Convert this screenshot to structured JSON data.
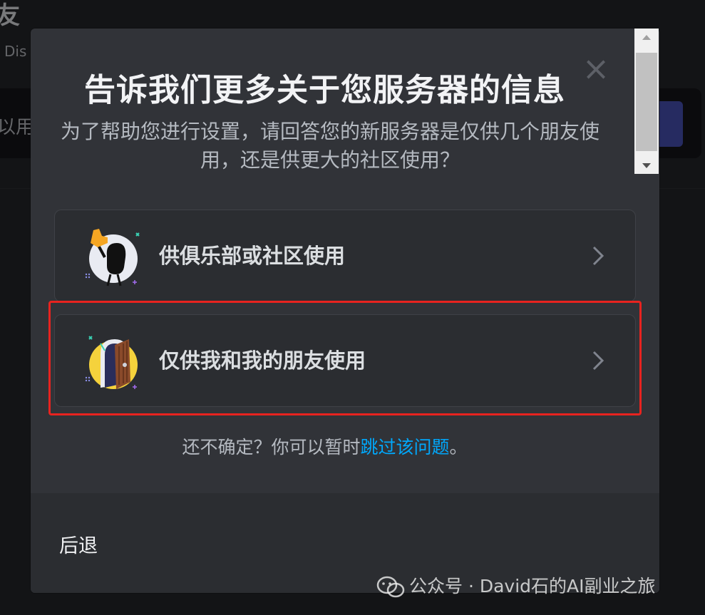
{
  "background": {
    "title_fragment": "友",
    "subtitle_fragment": "Dis",
    "bar_text_fragment": "以用"
  },
  "modal": {
    "title": "告诉我们更多关于您服务器的信息",
    "subtitle": "为了帮助您进行设置，请回答您的新服务器是仅供几个朋友使用，还是供更大的社区使用？",
    "close_icon": "close-icon",
    "options": [
      {
        "label": "供俱乐部或社区使用",
        "icon": "club-community-illustration-icon"
      },
      {
        "label": "仅供我和我的朋友使用",
        "icon": "friends-door-illustration-icon"
      }
    ],
    "skip_prefix": "还不确定？你可以暂时",
    "skip_link": "跳过该问题",
    "skip_suffix": "。",
    "back_label": "后退"
  },
  "watermark": {
    "text": "公众号 · David石的AI副业之旅",
    "icon": "wechat-icon"
  },
  "colors": {
    "modal_bg": "#313338",
    "option_bg": "#2b2d31",
    "link": "#00a8fc",
    "highlight": "#e8231f"
  }
}
